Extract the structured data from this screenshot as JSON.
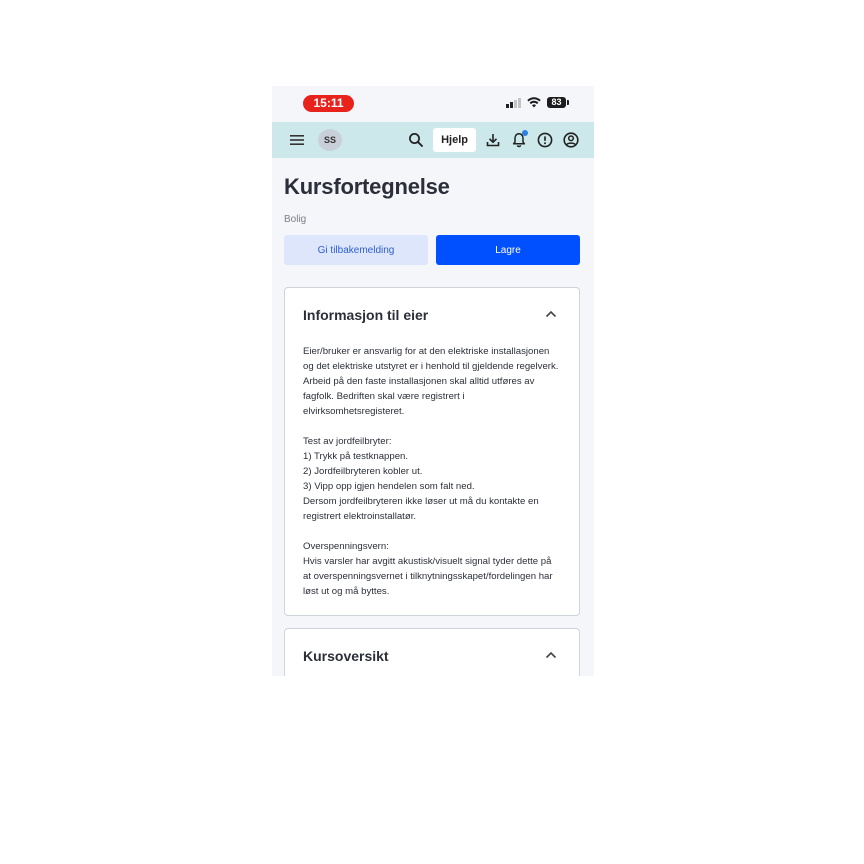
{
  "status_bar": {
    "time": "15:11",
    "battery": "83"
  },
  "app_bar": {
    "avatar_initials": "SS",
    "help_label": "Hjelp",
    "icons": [
      "menu-icon",
      "search-icon",
      "download-icon",
      "bell-icon",
      "alert-icon",
      "account-icon"
    ]
  },
  "page": {
    "title": "Kursfortegnelse",
    "subtitle": "Bolig",
    "feedback_label": "Gi tilbakemelding",
    "save_label": "Lagre"
  },
  "info_card": {
    "title": "Informasjon til eier",
    "paragraph1": "Eier/bruker er ansvarlig for at den elektriske installasjonen og det elektriske utstyret er i henhold til gjeldende regelverk. Arbeid på den faste installasjonen skal alltid utføres av fagfolk. Bedriften skal være registrert i elvirksomhetsregisteret.",
    "paragraph2": "Test av jordfeilbryter:\n1) Trykk på testknappen.\n2) Jordfeilbryteren kobler ut.\n3) Vipp opp igjen hendelen som falt ned.\nDersom jordfeilbryteren ikke løser ut må du kontakte en registrert elektroinstallatør.",
    "paragraph3": "Overspenningsvern:\nHvis varsler har avgitt akustisk/visuelt signal tyder dette på at overspenningsvernet i tilknytningsskapet/fordelingen har løst ut og må byttes."
  },
  "overview_card": {
    "title": "Kursoversikt"
  },
  "colors": {
    "appbar_bg": "#cde8ea",
    "primary": "#0050ff",
    "secondary_bg": "#dde6fb",
    "time_pill": "#e8231c"
  }
}
